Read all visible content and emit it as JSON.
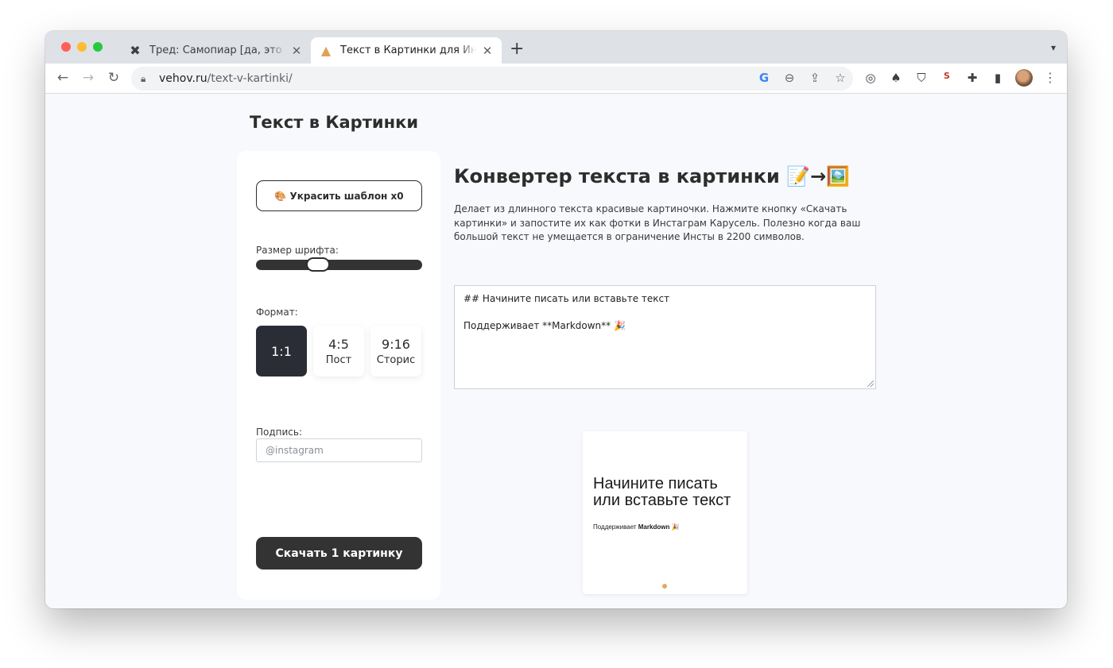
{
  "browser": {
    "tabs": [
      {
        "title": "Тред: Самопиар [да, это новая тема]",
        "icon": "✖"
      },
      {
        "title": "Текст в Картинки для Инстаграм",
        "icon": "▲"
      }
    ],
    "new_tab": "+",
    "address": {
      "domain": "vehov.ru",
      "path": "/text-v-kartinki/"
    }
  },
  "site": {
    "title": "Текст в Картинки"
  },
  "sidebar": {
    "decorate_label": "🎨 Украсить шаблон x0",
    "font_size_label": "Размер шрифта:",
    "font_size_value": 0.35,
    "format_label": "Формат:",
    "formats": [
      {
        "ratio": "1:1",
        "sub": ""
      },
      {
        "ratio": "4:5",
        "sub": "Пост"
      },
      {
        "ratio": "9:16",
        "sub": "Сторис"
      }
    ],
    "selected_format": "1:1",
    "signature_label": "Подпись:",
    "signature_placeholder": "@instagram",
    "download_label": "Скачать 1 картинку"
  },
  "main": {
    "heading": "Конвертер текста в картинки 📝→🖼️",
    "description": "Делает из длинного текста красивые картиночки. Нажмите кнопку «Скачать картинки» и запостите их как фотки в Инстаграм Карусель. Полезно когда ваш большой текст не умещается в ограничение Инсты в 2200 символов.",
    "editor_lines": [
      "## Начините писать или вставьте текст",
      "",
      "Поддерживает **Markdown** 🎉"
    ]
  },
  "preview": {
    "title": "Начините писать или вставьте текст",
    "sub_prefix": "Поддерживает ",
    "sub_bold": "Markdown",
    "sub_suffix": " 🎉",
    "dot_color": "#e3a95a"
  }
}
